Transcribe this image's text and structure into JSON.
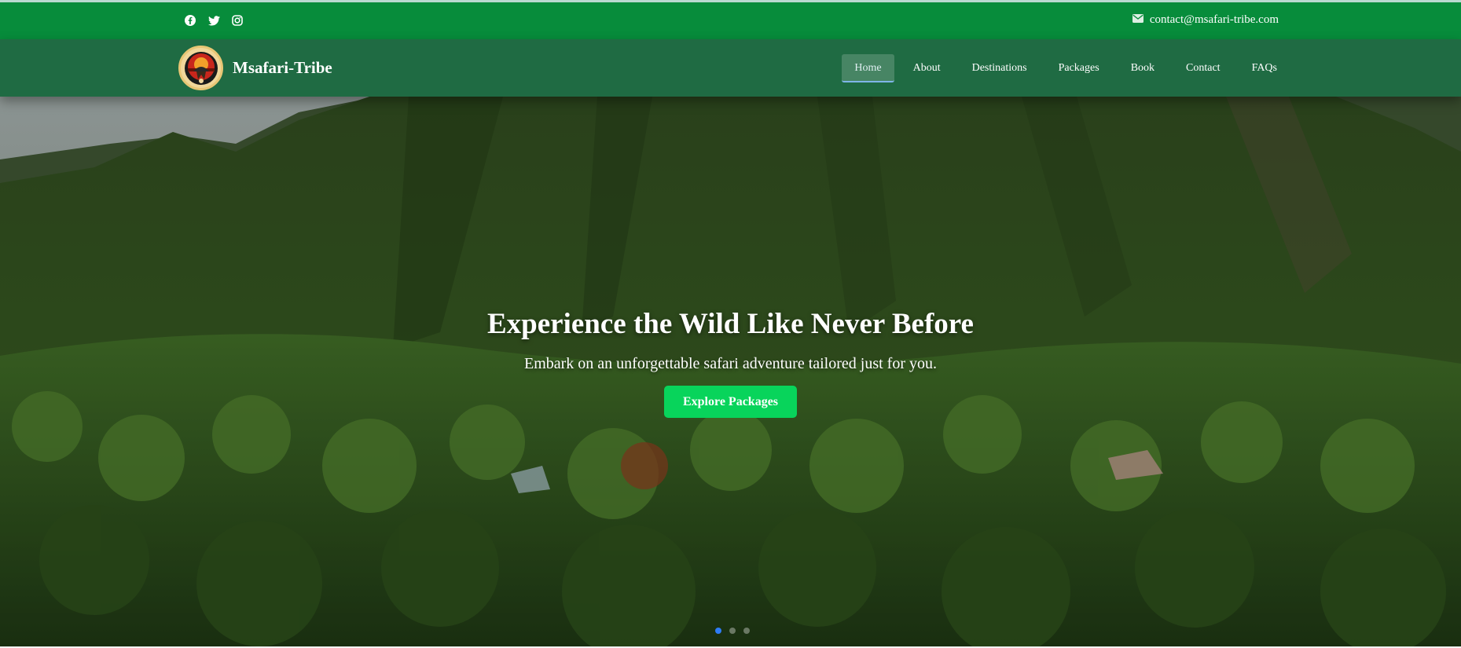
{
  "topbar": {
    "social": [
      {
        "icon": "facebook-icon",
        "label": "Facebook"
      },
      {
        "icon": "twitter-icon",
        "label": "Twitter"
      },
      {
        "icon": "instagram-icon",
        "label": "Instagram"
      }
    ],
    "email": "contact@msafari-tribe.com"
  },
  "brand": {
    "name": "Msafari-Tribe"
  },
  "nav": {
    "items": [
      {
        "label": "Home",
        "active": true
      },
      {
        "label": "About"
      },
      {
        "label": "Destinations"
      },
      {
        "label": "Packages"
      },
      {
        "label": "Book"
      },
      {
        "label": "Contact"
      },
      {
        "label": "FAQs"
      }
    ]
  },
  "hero": {
    "title": "Experience the Wild Like Never Before",
    "subtitle": "Embark on an unforgettable safari adventure tailored just for you.",
    "cta": "Explore Packages",
    "slides": {
      "count": 3,
      "active": 1
    }
  },
  "colors": {
    "topbar": "#078c3b",
    "navbar": "#1f6b43",
    "cta": "#08d45b",
    "active_dot": "#2e7cf6"
  }
}
